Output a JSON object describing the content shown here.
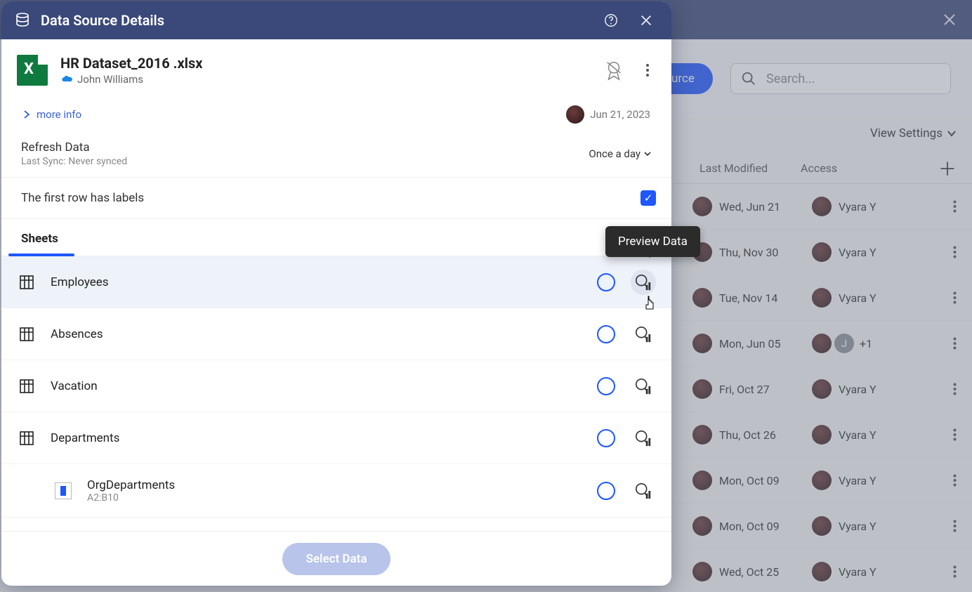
{
  "bg": {
    "button_label": "urce",
    "search_placeholder": "Search...",
    "view_settings": "View Settings",
    "columns": {
      "last_modified": "Last Modified",
      "access": "Access"
    },
    "rows": [
      {
        "date": "Wed, Jun 21",
        "access": "Vyara Y",
        "badge": null,
        "plus": null
      },
      {
        "date": "Thu, Nov 30",
        "access": "Vyara Y",
        "badge": null,
        "plus": null
      },
      {
        "date": "Tue, Nov 14",
        "access": "Vyara Y",
        "badge": null,
        "plus": null
      },
      {
        "date": "Mon, Jun 05",
        "access": "",
        "badge": "J",
        "plus": "+1"
      },
      {
        "date": "Fri, Oct 27",
        "access": "Vyara Y",
        "badge": null,
        "plus": null
      },
      {
        "date": "Thu, Oct 26",
        "access": "Vyara Y",
        "badge": null,
        "plus": null
      },
      {
        "date": "Mon, Oct 09",
        "access": "Vyara Y",
        "badge": null,
        "plus": null
      },
      {
        "date": "Mon, Oct 09",
        "access": "Vyara Y",
        "badge": null,
        "plus": null
      },
      {
        "date": "Wed, Oct 25",
        "access": "Vyara Y",
        "badge": null,
        "plus": null
      }
    ]
  },
  "modal": {
    "title": "Data Source Details",
    "file": {
      "name": "HR Dataset_2016 .xlsx",
      "owner": "John Williams"
    },
    "more_info": "more info",
    "updated": "Jun 21, 2023",
    "refresh": {
      "title": "Refresh Data",
      "subtitle": "Last Sync: Never synced",
      "freq": "Once a day"
    },
    "first_row_labels": "The first row has labels",
    "sheets_header": "Sheets",
    "sheets": [
      {
        "name": "Employees",
        "hover": true
      },
      {
        "name": "Absences",
        "hover": false
      },
      {
        "name": "Vacation",
        "hover": false
      },
      {
        "name": "Departments",
        "hover": false
      }
    ],
    "subitem": {
      "name": "OrgDepartments",
      "range": "A2:B10"
    },
    "select_button": "Select Data",
    "tooltip": "Preview Data"
  }
}
